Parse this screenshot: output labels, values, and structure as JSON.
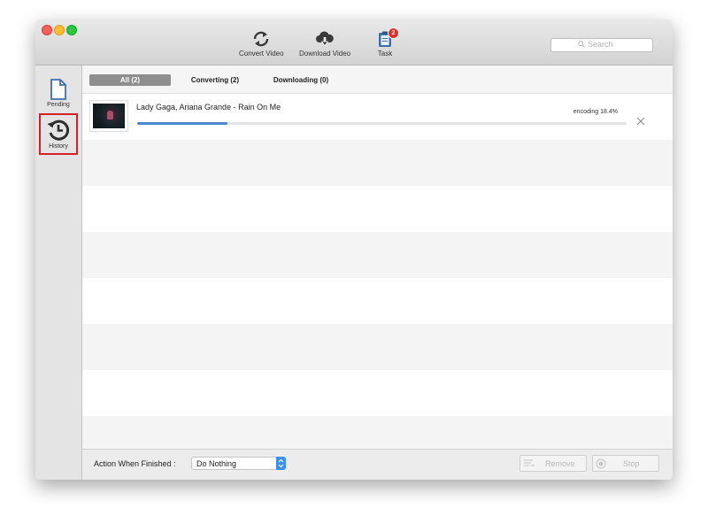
{
  "toolbar": {
    "convert_label": "Convert Video",
    "download_label": "Download Video",
    "task_label": "Task",
    "task_badge": "2",
    "search_placeholder": "Search"
  },
  "sidebar": {
    "pending_label": "Pending",
    "history_label": "History"
  },
  "tabs": [
    {
      "label": "All (2)",
      "active": true
    },
    {
      "label": "Converting (2)",
      "active": false
    },
    {
      "label": "Downloading (0)",
      "active": false
    }
  ],
  "tasks": [
    {
      "title": "Lady Gaga, Ariana Grande - Rain On Me",
      "status": "encoding 18.4%",
      "progress": 0.184
    }
  ],
  "footer": {
    "action_label": "Action When Finished :",
    "action_value": "Do Nothing",
    "remove_label": "Remove",
    "stop_label": "Stop"
  },
  "colors": {
    "accent": "#4a86cf",
    "highlight": "#d32029",
    "badge": "#e0312b"
  }
}
